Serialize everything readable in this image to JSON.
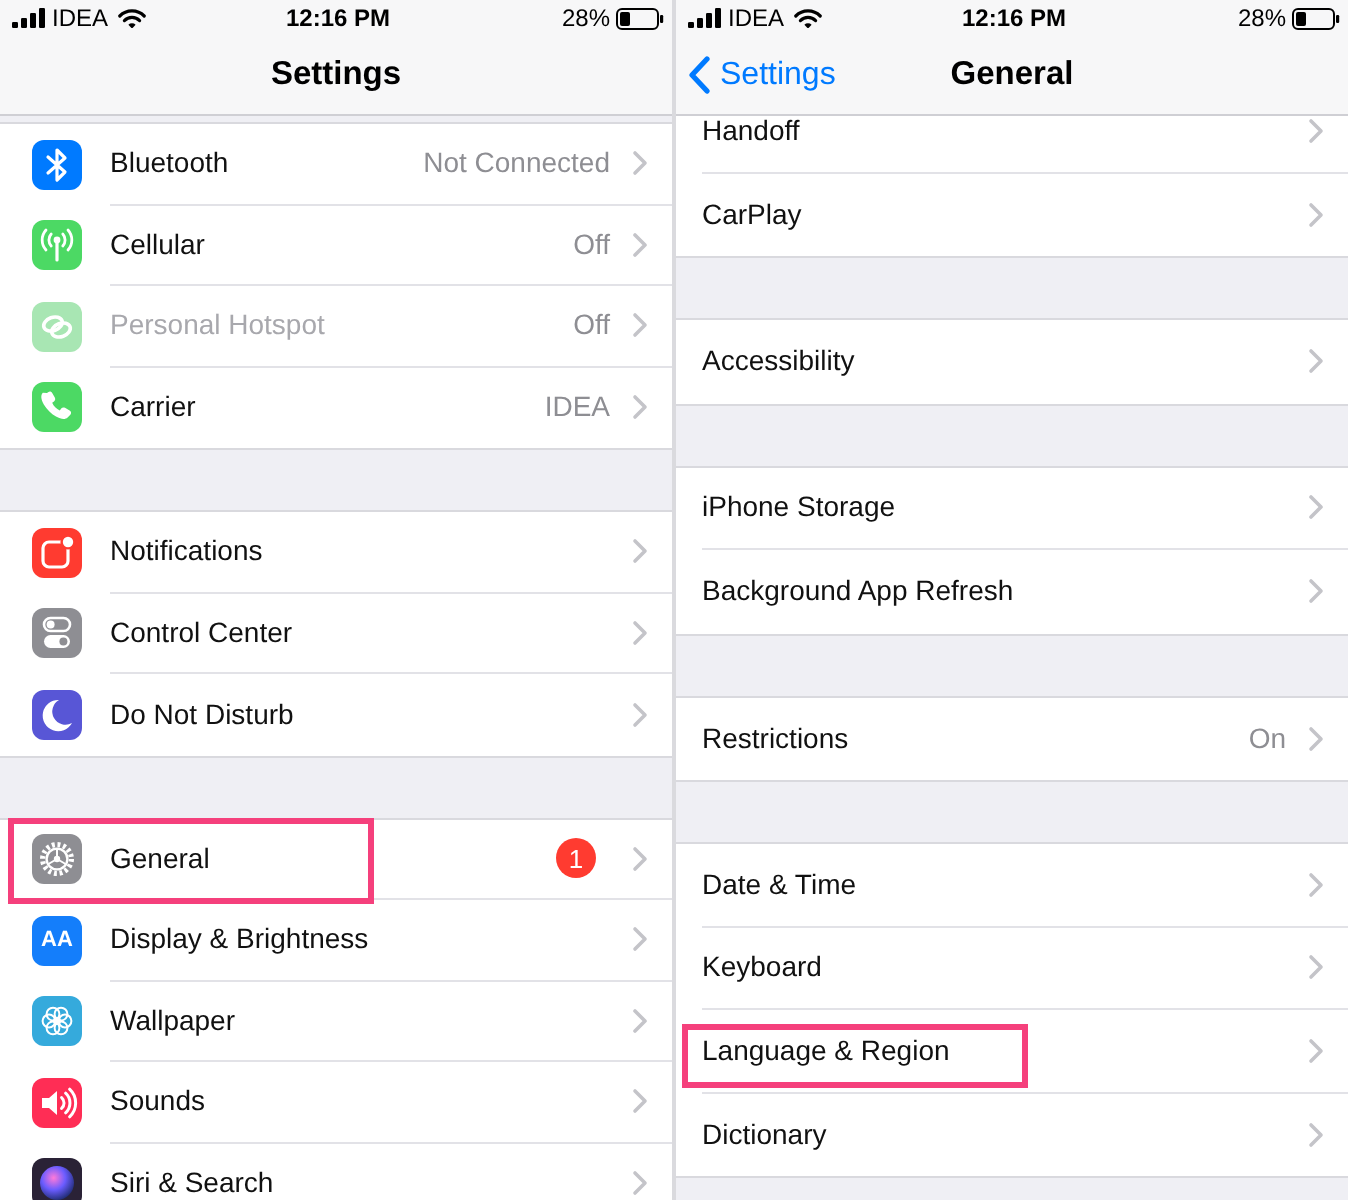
{
  "screens": [
    {
      "status_bar": {
        "carrier": "IDEA",
        "time": "12:16 PM",
        "battery": "28%"
      },
      "nav_bar": {
        "title": "Settings"
      },
      "groups": [
        {
          "items": [
            {
              "label": "Bluetooth",
              "value": "Not Connected",
              "color": "#007aff",
              "disabled": false,
              "highlighted": false
            },
            {
              "label": "Cellular",
              "value": "Off",
              "color": "#4cd964",
              "disabled": false,
              "highlighted": false
            },
            {
              "label": "Personal Hotspot",
              "value": "Off",
              "color": "#a8e6b3",
              "disabled": true,
              "highlighted": false
            },
            {
              "label": "Carrier",
              "value": "IDEA",
              "color": "#4cd964",
              "disabled": false,
              "highlighted": false
            }
          ]
        },
        {
          "items": [
            {
              "label": "Notifications",
              "color": "#ff3b30",
              "disabled": false,
              "highlighted": false
            },
            {
              "label": "Control Center",
              "color": "#8e8e93",
              "disabled": false,
              "highlighted": false
            },
            {
              "label": "Do Not Disturb",
              "color": "#5856d6",
              "disabled": false,
              "highlighted": false
            }
          ]
        },
        {
          "items": [
            {
              "label": "General",
              "badge": "1",
              "color": "#8e8e93",
              "disabled": false,
              "highlighted": true
            },
            {
              "label": "Display & Brightness",
              "icon_text": "AA",
              "color": "#147efb",
              "disabled": false,
              "highlighted": false
            },
            {
              "label": "Wallpaper",
              "color": "#35aadc",
              "disabled": false,
              "highlighted": false
            },
            {
              "label": "Sounds",
              "color": "#ff2d55",
              "disabled": false,
              "highlighted": false
            },
            {
              "label": "Siri & Search",
              "color": "#2a2236",
              "disabled": false,
              "highlighted": false
            }
          ]
        }
      ]
    },
    {
      "status_bar": {
        "carrier": "IDEA",
        "time": "12:16 PM",
        "battery": "28%"
      },
      "nav_bar": {
        "back": "Settings",
        "title": "General"
      },
      "groups": [
        {
          "items": [
            {
              "label": "Handoff",
              "highlighted": false
            },
            {
              "label": "CarPlay",
              "highlighted": false
            }
          ]
        },
        {
          "items": [
            {
              "label": "Accessibility",
              "highlighted": false
            }
          ]
        },
        {
          "items": [
            {
              "label": "iPhone Storage",
              "highlighted": false
            },
            {
              "label": "Background App Refresh",
              "highlighted": false
            }
          ]
        },
        {
          "items": [
            {
              "label": "Restrictions",
              "value": "On",
              "highlighted": false
            }
          ]
        },
        {
          "items": [
            {
              "label": "Date & Time",
              "highlighted": false
            },
            {
              "label": "Keyboard",
              "highlighted": false
            },
            {
              "label": "Language & Region",
              "highlighted": true
            },
            {
              "label": "Dictionary",
              "highlighted": false
            }
          ]
        }
      ]
    }
  ]
}
